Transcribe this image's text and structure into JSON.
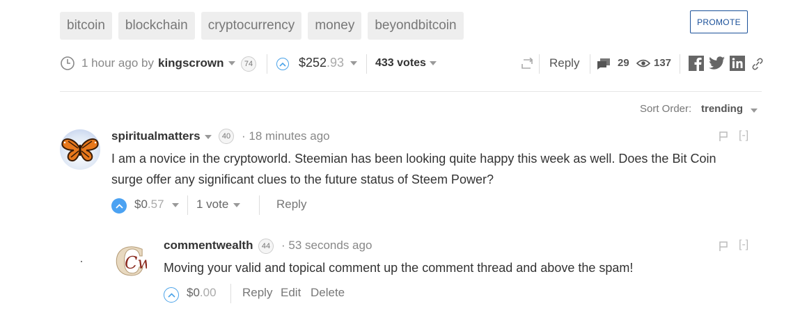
{
  "tags": [
    "bitcoin",
    "blockchain",
    "cryptocurrency",
    "money",
    "beyondbitcoin"
  ],
  "promote_label": "PROMOTE",
  "post_meta": {
    "time": "1 hour ago by",
    "author": "kingscrown",
    "reputation": "74",
    "payout_main": "$252",
    "payout_cents": ".93",
    "votes": "433 votes",
    "reply": "Reply",
    "comments_count": "29",
    "views_count": "137"
  },
  "sort": {
    "label": "Sort Order:",
    "value": "trending"
  },
  "comments": [
    {
      "author": "spiritualmatters",
      "reputation": "40",
      "time": "· 18 minutes ago",
      "body_line1": "I am a novice in the cryptoworld. Steemian has been looking quite happy this week as well. Does the Bit Coin",
      "body_line2": "surge offer any significant clues to the future status of Steem Power?",
      "payout_main": "$0",
      "payout_cents": ".57",
      "votes": "1 vote",
      "reply": "Reply",
      "collapse": "[-]"
    },
    {
      "author": "commentwealth",
      "reputation": "44",
      "time": "· 53 seconds ago",
      "body": "Moving your valid and topical comment up the comment thread and above the spam!",
      "payout_main": "$0",
      "payout_cents": ".00",
      "reply": "Reply",
      "edit": "Edit",
      "delete": "Delete",
      "collapse": "[-]",
      "avatar_letters": "Cw"
    }
  ]
}
